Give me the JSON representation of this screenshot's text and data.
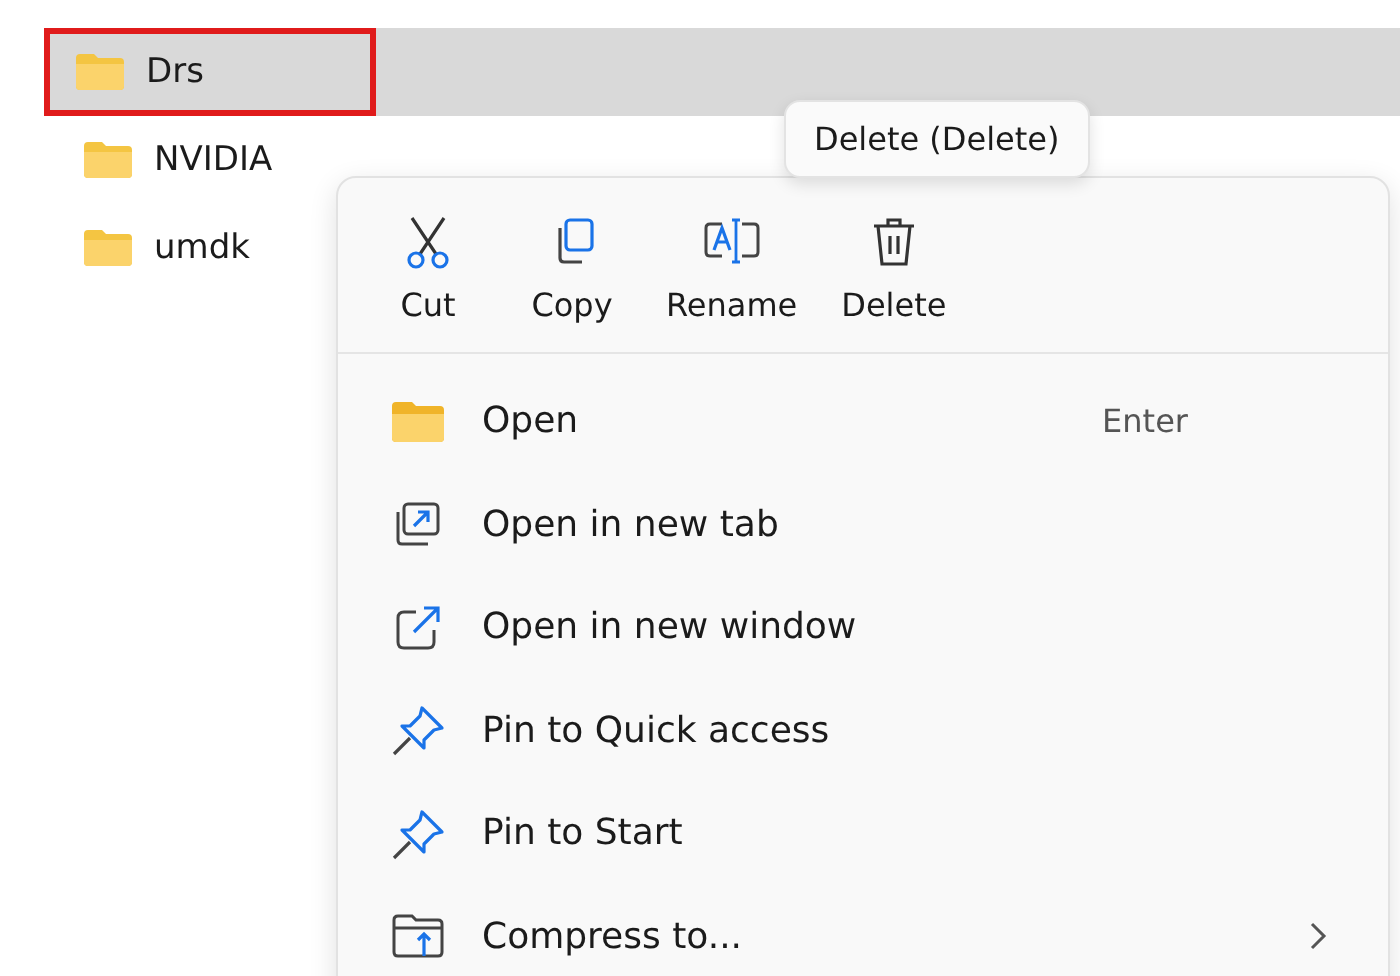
{
  "files": [
    {
      "name": "Drs",
      "selected": true,
      "annotated": true
    },
    {
      "name": "NVIDIA",
      "selected": false,
      "annotated": false
    },
    {
      "name": "umdk",
      "selected": false,
      "annotated": false
    }
  ],
  "tooltip": "Delete (Delete)",
  "context_menu": {
    "actions": [
      {
        "kind": "cut",
        "label": "Cut"
      },
      {
        "kind": "copy",
        "label": "Copy"
      },
      {
        "kind": "rename",
        "label": "Rename"
      },
      {
        "kind": "delete",
        "label": "Delete"
      }
    ],
    "items": [
      {
        "kind": "folder",
        "label": "Open",
        "shortcut": "Enter",
        "submenu": false
      },
      {
        "kind": "tab",
        "label": "Open in new tab",
        "submenu": false
      },
      {
        "kind": "window",
        "label": "Open in new window",
        "submenu": false
      },
      {
        "kind": "pin",
        "label": "Pin to Quick access",
        "submenu": false
      },
      {
        "kind": "pin",
        "label": "Pin to Start",
        "submenu": false
      },
      {
        "kind": "compress",
        "label": "Compress to...",
        "submenu": true
      }
    ]
  }
}
